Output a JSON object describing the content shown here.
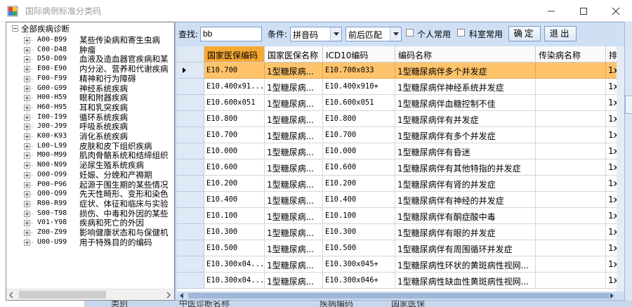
{
  "window": {
    "title": "国际病例标准分类码"
  },
  "tree": {
    "root_label": "全部疾病诊断",
    "items": [
      {
        "code": "A00-B99",
        "name": "某些传染病和寄生虫病"
      },
      {
        "code": "C00-D48",
        "name": "肿瘤"
      },
      {
        "code": "D50-D89",
        "name": "血液及造血器官疾病和某"
      },
      {
        "code": "E00-E90",
        "name": "内分泌、营养和代谢疾病"
      },
      {
        "code": "F00-F99",
        "name": "精神和行为障碍"
      },
      {
        "code": "G00-G99",
        "name": "神经系统疾病"
      },
      {
        "code": "H00-H59",
        "name": "眼和附器疾病"
      },
      {
        "code": "H60-H95",
        "name": "耳和乳突疾病"
      },
      {
        "code": "I00-I99",
        "name": "循环系统疾病"
      },
      {
        "code": "J00-J99",
        "name": "呼吸系统疾病"
      },
      {
        "code": "K00-K93",
        "name": "消化系统疾病"
      },
      {
        "code": "L00-L99",
        "name": "皮肤和皮下组织疾病"
      },
      {
        "code": "M00-M99",
        "name": "肌肉骨骼系统和结缔组织"
      },
      {
        "code": "N00-N99",
        "name": "泌尿生殖系统疾病"
      },
      {
        "code": "O00-O99",
        "name": "妊娠、分娩和产褥期"
      },
      {
        "code": "P00-P96",
        "name": "起源于围生期的某些情况"
      },
      {
        "code": "Q00-Q99",
        "name": "先天性畸形、变形和染色"
      },
      {
        "code": "R00-R99",
        "name": "症状、体征和临床与实验"
      },
      {
        "code": "S00-T98",
        "name": "损伤、中毒和外因的某些"
      },
      {
        "code": "V01-Y98",
        "name": "疾病和死亡的外因"
      },
      {
        "code": "Z00-Z99",
        "name": "影响健康状态和与保健机"
      },
      {
        "code": "U00-U99",
        "name": "用于特殊目的的编码"
      }
    ]
  },
  "toolbar": {
    "search_label": "查找:",
    "search_value": "bb",
    "condition_label": "条件:",
    "condition_value": "拼音码",
    "match_value": "前后匹配",
    "personal_label": "个人常用",
    "dept_label": "科室常用",
    "confirm_label": "确定",
    "exit_label": "退出"
  },
  "grid": {
    "columns": [
      "国家医保编码",
      "国家医保名称",
      "ICD10编码",
      "编码名称",
      "传染病名称",
      "排"
    ],
    "rows": [
      {
        "code": "E10.700",
        "name": "1型糖尿病...",
        "icd": "E10.700x033",
        "desc": "1型糖尿病伴多个并发症",
        "inf": "",
        "extra": "1x"
      },
      {
        "code": "E10.400x91...",
        "name": "1型糖尿病...",
        "icd": "E10.400x910+",
        "desc": "1型糖尿病伴神经系统并发症",
        "inf": "",
        "extra": "1x"
      },
      {
        "code": "E10.600x051",
        "name": "1型糖尿病...",
        "icd": "E10.600x051",
        "desc": "1型糖尿病伴血糖控制不佳",
        "inf": "",
        "extra": "1x"
      },
      {
        "code": "E10.800",
        "name": "1型糖尿病...",
        "icd": "E10.800",
        "desc": "1型糖尿病伴有并发症",
        "inf": "",
        "extra": "1x"
      },
      {
        "code": "E10.700",
        "name": "1型糖尿病...",
        "icd": "E10.700",
        "desc": "1型糖尿病伴有多个并发症",
        "inf": "",
        "extra": "1x"
      },
      {
        "code": "E10.000",
        "name": "1型糖尿病...",
        "icd": "E10.000",
        "desc": "1型糖尿病伴有昏迷",
        "inf": "",
        "extra": "1x"
      },
      {
        "code": "E10.600",
        "name": "1型糖尿病...",
        "icd": "E10.600",
        "desc": "1型糖尿病伴有其他特指的并发症",
        "inf": "",
        "extra": "1x"
      },
      {
        "code": "E10.200",
        "name": "1型糖尿病...",
        "icd": "E10.200",
        "desc": "1型糖尿病伴有肾的并发症",
        "inf": "",
        "extra": "1x"
      },
      {
        "code": "E10.400",
        "name": "1型糖尿病...",
        "icd": "E10.400",
        "desc": "1型糖尿病伴有神经的并发症",
        "inf": "",
        "extra": "1x"
      },
      {
        "code": "E10.100",
        "name": "1型糖尿病...",
        "icd": "E10.100",
        "desc": "1型糖尿病伴有酮症酸中毒",
        "inf": "",
        "extra": "1x"
      },
      {
        "code": "E10.300",
        "name": "1型糖尿病...",
        "icd": "E10.300",
        "desc": "1型糖尿病伴有眼的并发症",
        "inf": "",
        "extra": "1x"
      },
      {
        "code": "E10.500",
        "name": "1型糖尿病...",
        "icd": "E10.500",
        "desc": "1型糖尿病伴有周围循环并发症",
        "inf": "",
        "extra": "1x"
      },
      {
        "code": "E10.300x04...",
        "name": "1型糖尿病...",
        "icd": "E10.300x045+",
        "desc": "1型糖尿病性环状的黄斑病性视网...",
        "inf": "",
        "extra": "1x"
      },
      {
        "code": "E10.300x04...",
        "name": "1型糖尿病...",
        "icd": "E10.300x046+",
        "desc": "1型糖尿病性缺血性黄斑病性视网...",
        "inf": "",
        "extra": "1x"
      }
    ]
  },
  "background": {
    "labels": [
      "类别",
      "中医诊断名称",
      "疾病编码",
      "国家医保"
    ]
  },
  "colors": {
    "panel_bg": "#cfe0f5",
    "selected_header": "#f7a934",
    "selected_row": "#ffc46b"
  }
}
